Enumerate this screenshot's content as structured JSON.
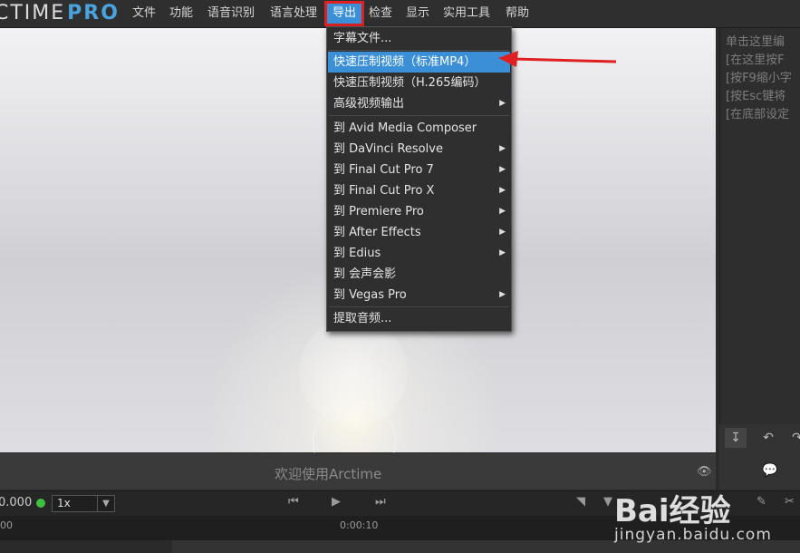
{
  "app": {
    "logo_main": "CTIME",
    "logo_pro": "PRO"
  },
  "menubar": {
    "items": [
      "文件",
      "功能",
      "语音识别",
      "语言处理",
      "导出",
      "检查",
      "显示",
      "实用工具",
      "帮助"
    ]
  },
  "export_menu": {
    "items": [
      {
        "label": "字幕文件...",
        "submenu": false
      },
      {
        "label": "快速压制视频（标准MP4）",
        "submenu": false,
        "highlighted": true
      },
      {
        "label": "快速压制视频（H.265编码）",
        "submenu": false
      },
      {
        "label": "高级视频输出",
        "submenu": true
      },
      {
        "label": "到 Avid Media Composer",
        "submenu": false
      },
      {
        "label": "到 DaVinci Resolve",
        "submenu": true
      },
      {
        "label": "到 Final Cut Pro 7",
        "submenu": true
      },
      {
        "label": "到 Final Cut Pro X",
        "submenu": true
      },
      {
        "label": "到 Premiere Pro",
        "submenu": true
      },
      {
        "label": "到 After Effects",
        "submenu": true
      },
      {
        "label": "到 Edius",
        "submenu": true
      },
      {
        "label": "到 会声会影",
        "submenu": false
      },
      {
        "label": "到 Vegas Pro",
        "submenu": true
      },
      {
        "label": "提取音频...",
        "submenu": false
      }
    ]
  },
  "right_panel": {
    "lines": [
      "单击这里编",
      "[在这里按F",
      "[按F9缩小字",
      "[按Esc键将",
      "[在底部设定"
    ]
  },
  "caption": {
    "welcome": "欢迎使用Arctime"
  },
  "controls": {
    "time": "0.000",
    "speed": "1x"
  },
  "timeline": {
    "start_label": "00",
    "mid_label": "0:00:10"
  },
  "watermark": {
    "logo": "Bai经验",
    "url": "jingyan.baidu.com"
  },
  "colors": {
    "accent": "#3b8fd6",
    "highlight_border": "#e02020",
    "arrow": "#e02020",
    "status_dot": "#3fbf3f"
  }
}
